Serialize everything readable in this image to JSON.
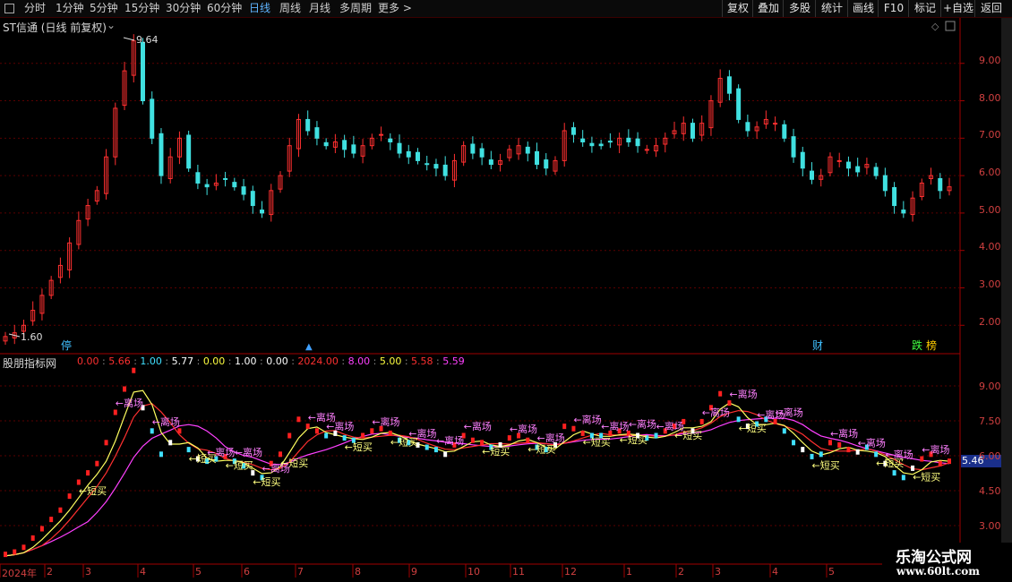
{
  "toolbar": {
    "periods": [
      "分时",
      "1分钟",
      "5分钟",
      "15分钟",
      "30分钟",
      "60分钟",
      "日线",
      "周线",
      "月线",
      "多周期",
      "更多 >"
    ],
    "active_period": "日线",
    "buttons": [
      "复权",
      "叠加",
      "多股",
      "统计",
      "画线",
      "F10",
      "标记",
      "+自选",
      "返回"
    ]
  },
  "main_chart": {
    "title": "ST信通 (日线 前复权)",
    "high_label": "9.64",
    "low_label": "1.60",
    "price_axis": [
      "9.00",
      "8.00",
      "7.00",
      "6.00",
      "5.00",
      "4.00",
      "3.00",
      "2.00"
    ],
    "markers": [
      "停",
      "财",
      "跌",
      "榜"
    ]
  },
  "indicator": {
    "name": "股朋指标网",
    "values": [
      {
        "text": "0.00",
        "color": "#ff3030"
      },
      {
        "text": "5.66",
        "color": "#ff3030"
      },
      {
        "text": "1.00",
        "color": "#40e0ff"
      },
      {
        "text": "5.77",
        "color": "#ffffff"
      },
      {
        "text": "0.00",
        "color": "#ffff40"
      },
      {
        "text": "1.00",
        "color": "#ffffff"
      },
      {
        "text": "0.00",
        "color": "#ffffff"
      },
      {
        "text": "2024.00",
        "color": "#ff3030"
      },
      {
        "text": "8.00",
        "color": "#ff40ff"
      },
      {
        "text": "5.00",
        "color": "#ffff40"
      },
      {
        "text": "5.58",
        "color": "#ff3030"
      },
      {
        "text": "5.59",
        "color": "#ff40ff"
      }
    ],
    "price_axis": [
      "9.00",
      "7.50",
      "6.00",
      "4.50",
      "3.00"
    ],
    "current_price": "5.46",
    "leave_label": "离场",
    "buy_label": "短买"
  },
  "time_axis": [
    "2024年",
    "2",
    "3",
    "4",
    "5",
    "6",
    "7",
    "8",
    "9",
    "10",
    "11",
    "12",
    "1",
    "2",
    "3",
    "4",
    "5"
  ],
  "watermark": {
    "line1": "乐淘公式网",
    "line2": "www.60lt.com"
  },
  "chart_data": {
    "type": "candlestick",
    "title": "ST信通 (日线 前复权)",
    "ylim": [
      1.4,
      10.2
    ],
    "ticks": [
      2,
      3,
      4,
      5,
      6,
      7,
      8,
      9
    ],
    "max": 9.64,
    "min": 1.6,
    "x_month_labels": [
      "2024年",
      "2",
      "3",
      "4",
      "5",
      "6",
      "7",
      "8",
      "9",
      "10",
      "11",
      "12",
      "1",
      "2",
      "3",
      "4",
      "5"
    ],
    "approx_close_path": [
      1.7,
      1.8,
      2.0,
      2.4,
      2.8,
      3.2,
      3.6,
      4.2,
      4.8,
      5.2,
      5.6,
      6.5,
      7.8,
      8.8,
      9.6,
      8.0,
      7.0,
      6.0,
      6.5,
      7.0,
      6.2,
      5.8,
      5.7,
      5.8,
      5.9,
      5.7,
      5.5,
      5.2,
      5.0,
      5.6,
      6.0,
      6.8,
      7.5,
      7.2,
      7.0,
      6.8,
      6.9,
      6.7,
      6.6,
      6.8,
      7.0,
      7.1,
      6.9,
      6.6,
      6.5,
      6.4,
      6.3,
      6.2,
      6.0,
      6.4,
      6.8,
      6.6,
      6.5,
      6.3,
      6.4,
      6.7,
      6.8,
      6.6,
      6.3,
      6.2,
      6.4,
      7.2,
      7.1,
      6.9,
      6.8,
      6.8,
      6.9,
      7.0,
      6.9,
      6.8,
      6.7,
      6.8,
      7.0,
      7.2,
      7.4,
      7.0,
      7.4,
      8.0,
      8.6,
      8.2,
      7.5,
      7.2,
      7.3,
      7.5,
      7.4,
      7.0,
      6.5,
      6.2,
      5.9,
      6.0,
      6.5,
      6.4,
      6.2,
      6.1,
      6.3,
      6.0,
      5.6,
      5.2,
      5.0,
      5.4,
      5.8,
      6.0,
      5.6,
      5.7
    ]
  }
}
